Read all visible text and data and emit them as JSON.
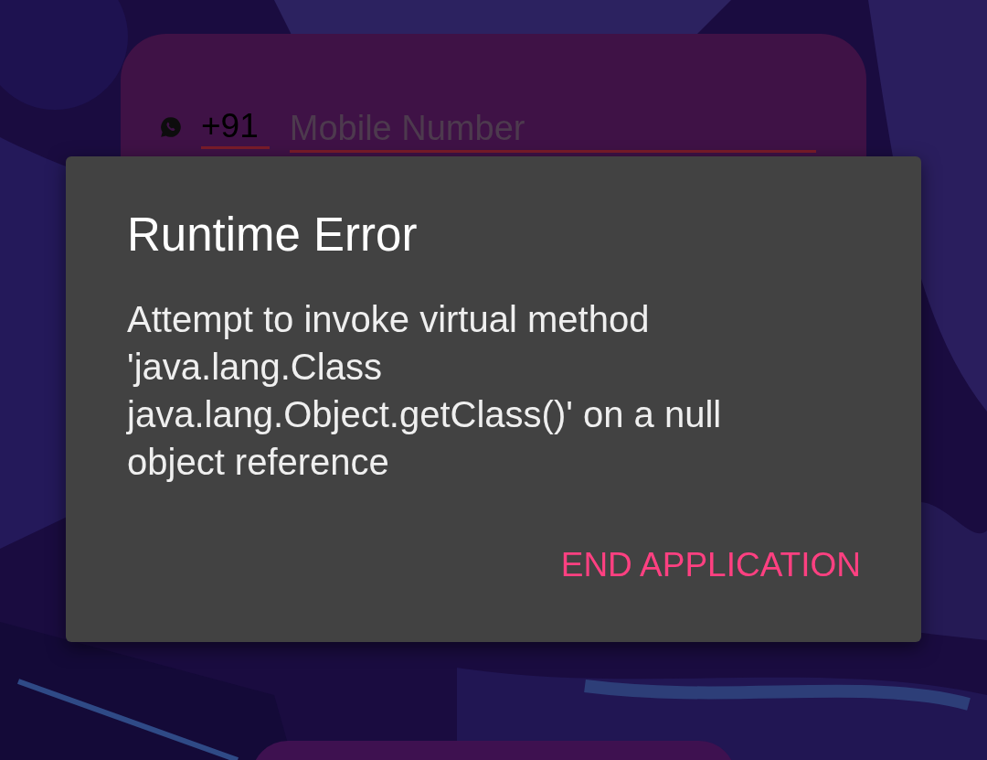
{
  "login_card": {
    "country_code": "+91",
    "phone_field": {
      "placeholder": "Mobile Number"
    }
  },
  "dialog": {
    "title": "Runtime Error",
    "message": "Attempt to invoke virtual method 'java.lang.Class java.lang.Object.getClass()' on a null object reference",
    "button": "END APPLICATION"
  }
}
